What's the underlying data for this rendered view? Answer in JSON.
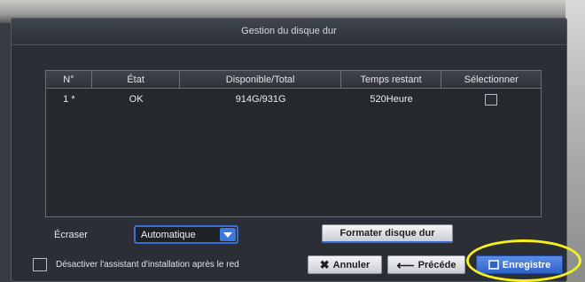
{
  "dialog": {
    "title": "Gestion du disque dur"
  },
  "table": {
    "headers": [
      "N°",
      "État",
      "Disponible/Total",
      "Temps restant",
      "Sélectionner"
    ],
    "rows": [
      {
        "num": "1 *",
        "etat": "OK",
        "disponible": "914G/931G",
        "temps": "520Heure",
        "selected": false
      }
    ]
  },
  "overwrite": {
    "label": "Écraser",
    "value": "Automatique"
  },
  "format_button": "Formater disque dur",
  "footer": {
    "checkbox_label": "Désactiver l'assistant d'installation après le red",
    "cancel": "Annuler",
    "previous": "Précéde",
    "save": "Enregistre"
  },
  "colors": {
    "accent": "#3b6fd6",
    "highlight": "#f7f01a"
  },
  "icons": {
    "cancel": "close-icon",
    "previous": "arrow-left-icon",
    "save": "save-icon",
    "dropdown": "chevron-down-icon"
  }
}
